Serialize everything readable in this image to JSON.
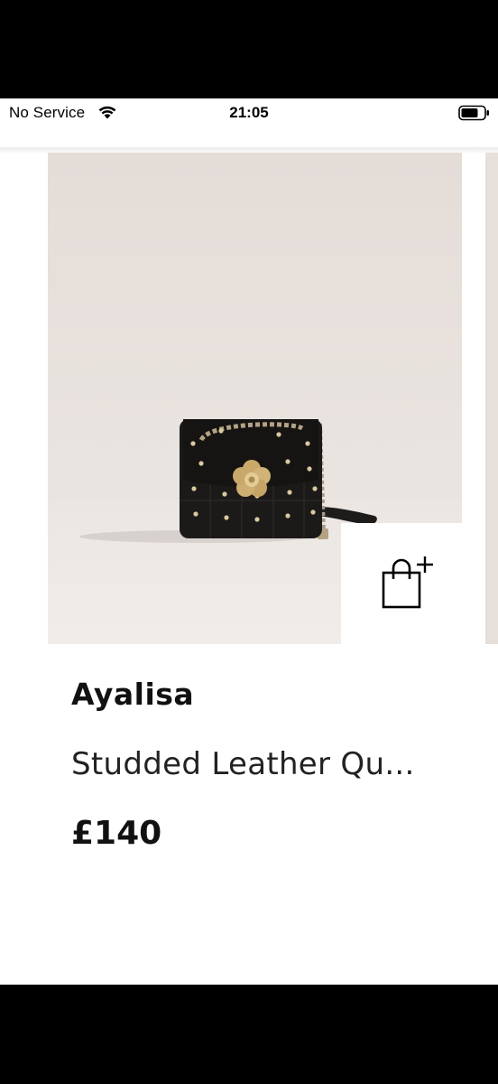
{
  "status_bar": {
    "carrier": "No Service",
    "time": "21:05",
    "icons": [
      "wifi-icon",
      "battery-icon"
    ]
  },
  "product": {
    "brand": "Ayalisa",
    "name": "Studded Leather Qu...",
    "price": "£140",
    "add_to_bag_icon": "shopping-bag-plus-icon"
  },
  "colors": {
    "image_background": "#e6dfda",
    "bag_leather": "#1c1a19",
    "hardware_gold": "#c9a96a",
    "text": "#111111"
  }
}
